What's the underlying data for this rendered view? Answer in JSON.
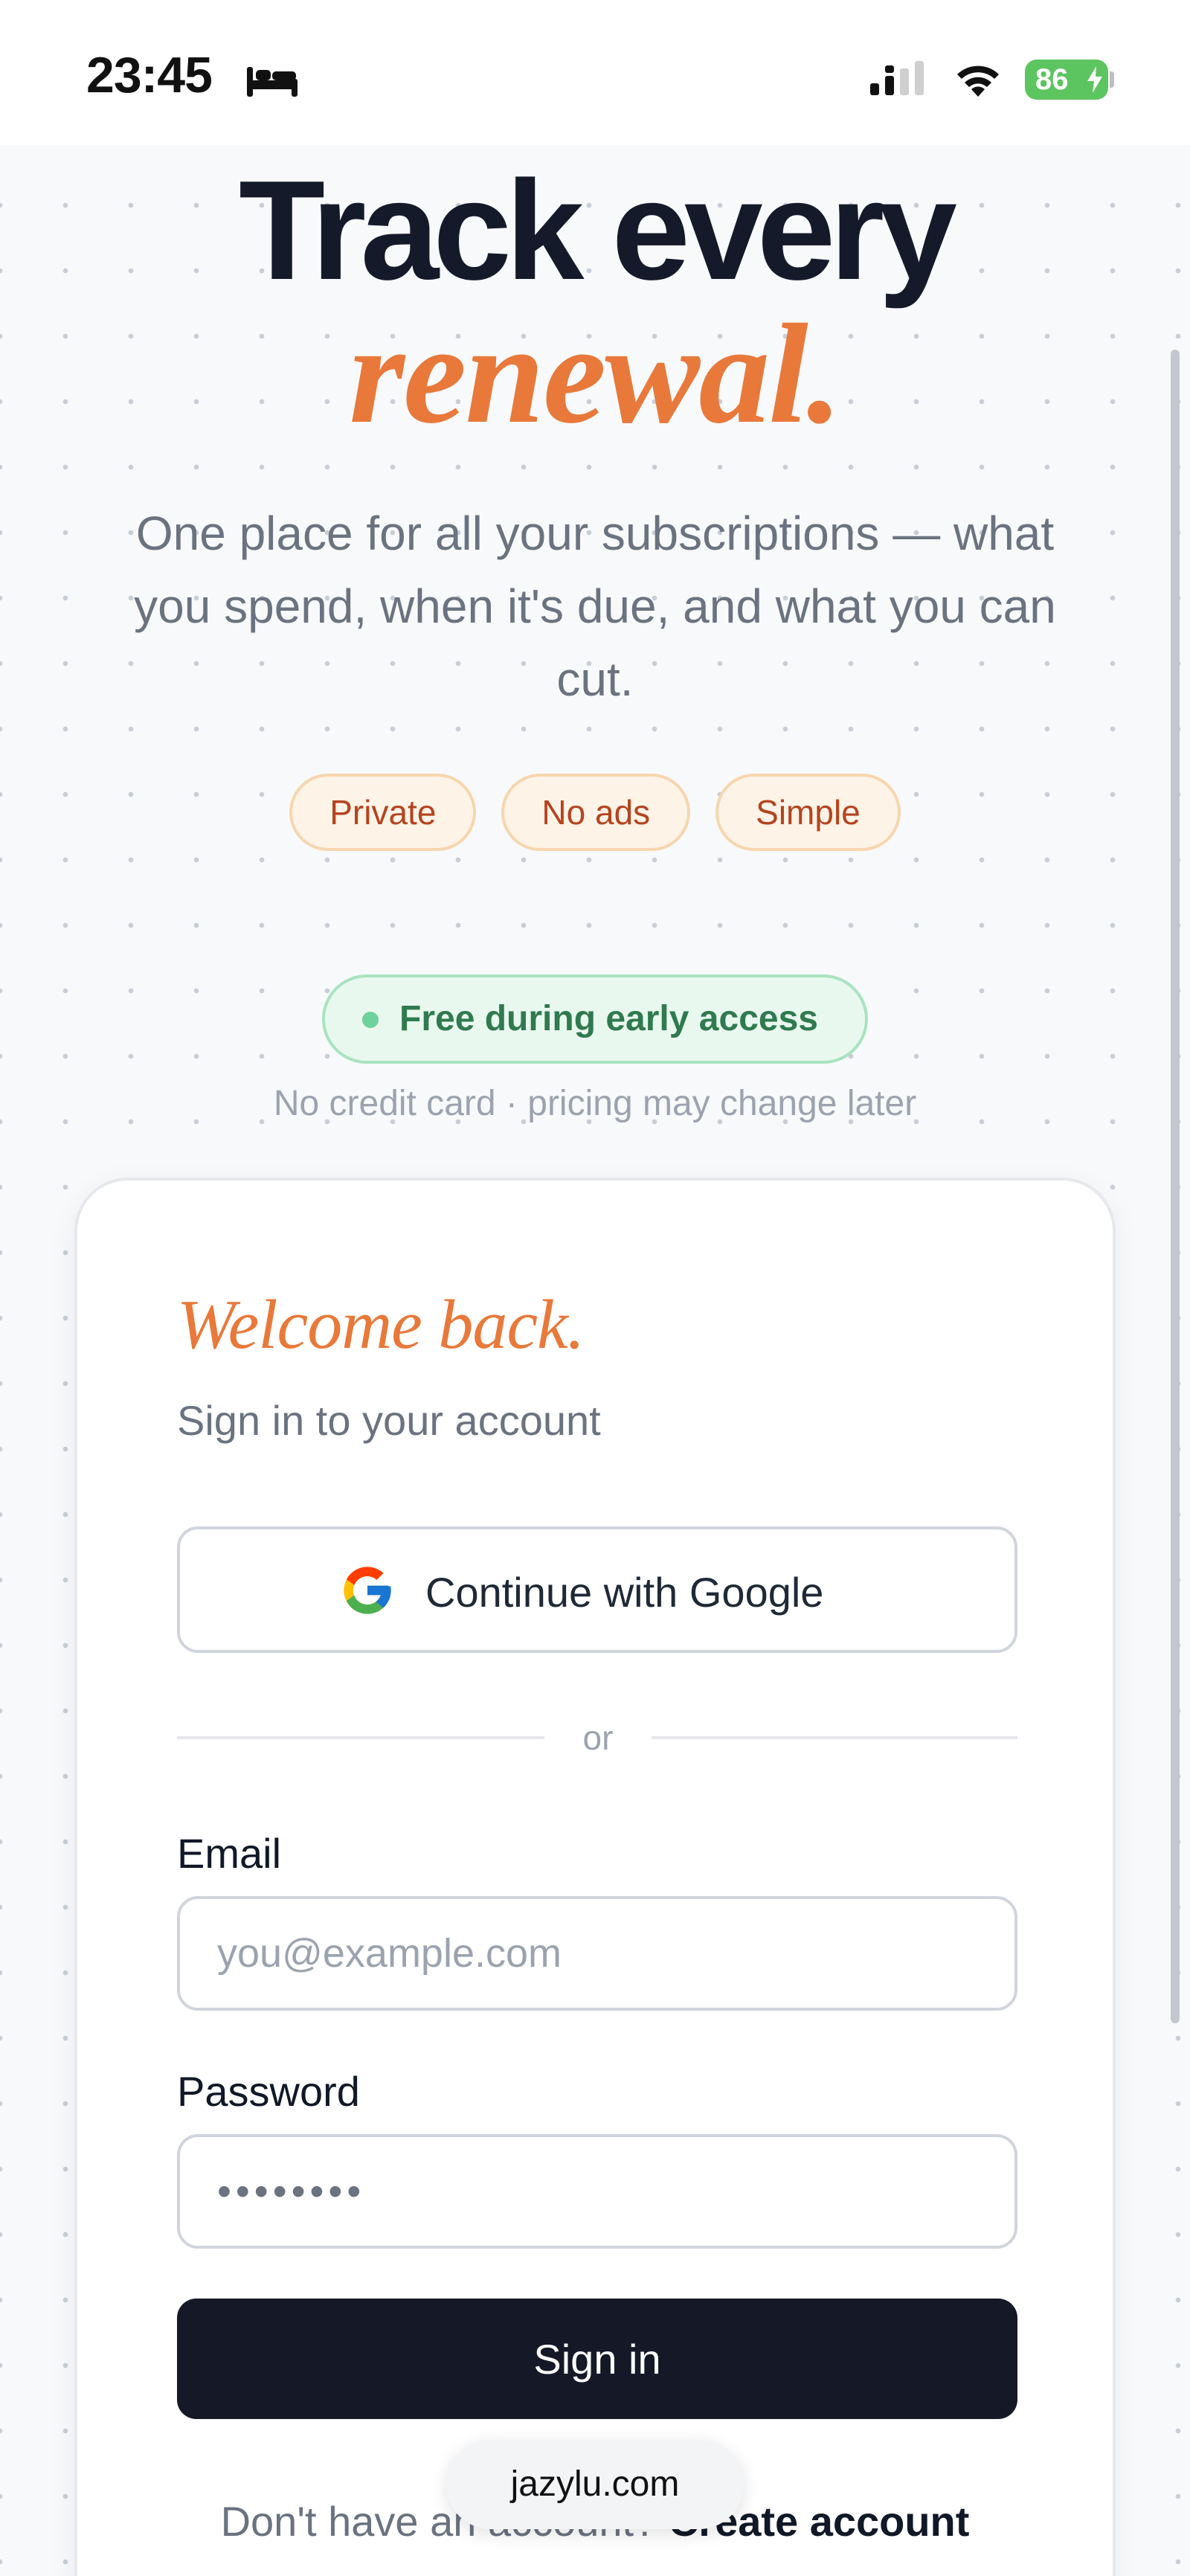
{
  "status_bar": {
    "time": "23:45",
    "battery": "86",
    "icons": [
      "bed-icon",
      "signal-icon",
      "wifi-icon",
      "battery-icon"
    ]
  },
  "hero": {
    "title_line1": "Track every",
    "title_line2": "renewal.",
    "subtitle": "One place for all your subscriptions — what you spend, when it's due, and what you can cut.",
    "pills": [
      "Private",
      "No ads",
      "Simple"
    ],
    "badge": "Free during early access",
    "badge_note": "No credit card · pricing may change later"
  },
  "colors": {
    "accent": "#e8793a",
    "dark": "#141827",
    "badge_green": "#2f7a4f"
  },
  "card": {
    "title": "Welcome back.",
    "subtitle": "Sign in to your account",
    "google_button": "Continue with Google",
    "divider": "or",
    "email_label": "Email",
    "email_placeholder": "you@example.com",
    "password_label": "Password",
    "password_value": "••••••••",
    "signin_button": "Sign in",
    "no_account": "Don't have an account?",
    "create_account": "Create account"
  },
  "browser": {
    "url": "jazylu.com"
  }
}
